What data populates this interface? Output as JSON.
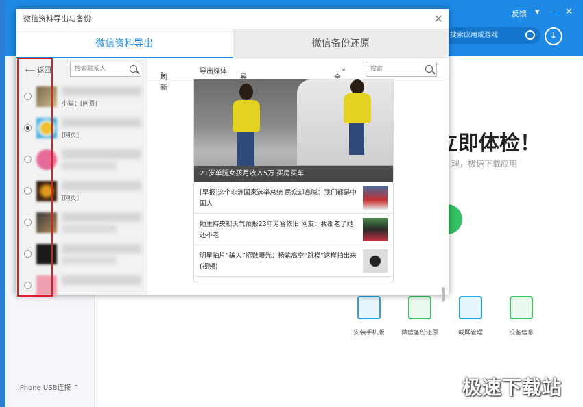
{
  "bg": {
    "feedback": "反馈",
    "search_placeholder": "搜索应用或游戏",
    "headline": "立即体检！",
    "subline": "理，极速下载应用",
    "connection": "iPhone  USB连接",
    "tools": [
      "安装手机版",
      "微信备份还原",
      "截屏管理",
      "设备信息"
    ],
    "watermark": "极速下载站"
  },
  "dialog": {
    "title": "微信资料导出与备份",
    "tabs": [
      "微信资料导出",
      "微信备份还原"
    ],
    "left": {
      "back_label": "返回",
      "search_placeholder": "搜索联系人",
      "contacts": [
        {
          "snippet": "小猫：[网页]",
          "selected": false
        },
        {
          "snippet": "[网页]",
          "selected": true
        },
        {
          "snippet": "",
          "selected": false
        },
        {
          "snippet": "[网页]",
          "selected": false
        },
        {
          "snippet": "",
          "selected": false
        },
        {
          "snippet": "",
          "selected": false
        },
        {
          "snippet": "",
          "selected": false
        }
      ]
    },
    "right": {
      "toolbar": {
        "refresh": "刷新",
        "export_media": "导出媒体",
        "export_msg": "导出消息",
        "filter": "全部",
        "search_placeholder": "搜索"
      },
      "hero_caption": "21岁单腿女孩月收入5万 买房买车",
      "news": [
        {
          "text": "[早报]这个非洲国家选举总统 民众却高喊：我们都是中国人"
        },
        {
          "text": "她主持央视天气预报23年芳容依旧 网友：我都老了她还不老"
        },
        {
          "text": "明星拍片“骗人”招数曝光：杨紫高空“跳楼”这样拍出来(视频)"
        }
      ]
    }
  }
}
